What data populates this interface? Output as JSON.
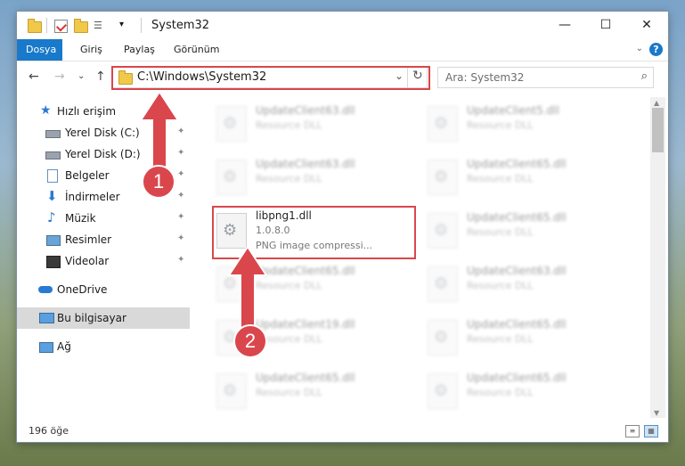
{
  "window": {
    "title": "System32",
    "quick_access_dropdown": "▾",
    "minimize": "—",
    "maximize": "☐",
    "close": "✕"
  },
  "ribbon": {
    "tabs": [
      "Dosya",
      "Giriş",
      "Paylaş",
      "Görünüm"
    ],
    "expand": "⌄",
    "help": "?"
  },
  "nav": {
    "back": "←",
    "forward": "→",
    "recent": "⌄",
    "up": "↑",
    "address": "C:\\Windows\\System32",
    "address_dropdown": "⌄",
    "refresh": "↻",
    "search_placeholder": "Ara: System32",
    "search_icon": "⌕"
  },
  "sidebar": {
    "items": [
      {
        "label": "Hızlı erişim",
        "icon": "star-icon",
        "pinned": false
      },
      {
        "label": "Yerel Disk (C:)",
        "icon": "drive-icon",
        "pinned": true
      },
      {
        "label": "Yerel Disk (D:)",
        "icon": "drive-icon",
        "pinned": true
      },
      {
        "label": "Belgeler",
        "icon": "document-icon",
        "pinned": true
      },
      {
        "label": "İndirmeler",
        "icon": "download-icon",
        "pinned": true
      },
      {
        "label": "Müzik",
        "icon": "music-icon",
        "pinned": true
      },
      {
        "label": "Resimler",
        "icon": "pictures-icon",
        "pinned": true
      },
      {
        "label": "Videolar",
        "icon": "video-icon",
        "pinned": true
      },
      {
        "label": "OneDrive",
        "icon": "cloud-icon",
        "pinned": false
      },
      {
        "label": "Bu bilgisayar",
        "icon": "computer-icon",
        "pinned": false,
        "selected": true
      },
      {
        "label": "Ağ",
        "icon": "network-icon",
        "pinned": false
      }
    ],
    "pin_glyph": "📌"
  },
  "files": {
    "highlighted": {
      "name": "libpng1.dll",
      "version": "1.0.8.0",
      "description": "PNG image compressi..."
    },
    "left_column": [
      {
        "name": "UpdateClient63.dll",
        "type": "Resource DLL"
      },
      {
        "name": "UpdateClient63.dll",
        "type": "Resource DLL"
      },
      {
        "name": "UpdateClient65.dll",
        "type": "Resource DLL"
      },
      {
        "name": "UpdateClient19.dll",
        "type": "Resource DLL"
      },
      {
        "name": "UpdateClient65.dll",
        "type": "Resource DLL"
      }
    ],
    "right_column": [
      {
        "name": "UpdateClient5.dll",
        "type": "Resource DLL"
      },
      {
        "name": "UpdateClient65.dll",
        "type": "Resource DLL"
      },
      {
        "name": "UpdateClient65.dll",
        "type": "Resource DLL"
      },
      {
        "name": "UpdateClient63.dll",
        "type": "Resource DLL"
      },
      {
        "name": "UpdateClient65.dll",
        "type": "Resource DLL"
      },
      {
        "name": "UpdateClient65.dll",
        "type": "Resource DLL"
      }
    ]
  },
  "status": {
    "count": "196 öğe"
  },
  "annotations": {
    "step1": "1",
    "step2": "2",
    "color": "#d9474c"
  }
}
